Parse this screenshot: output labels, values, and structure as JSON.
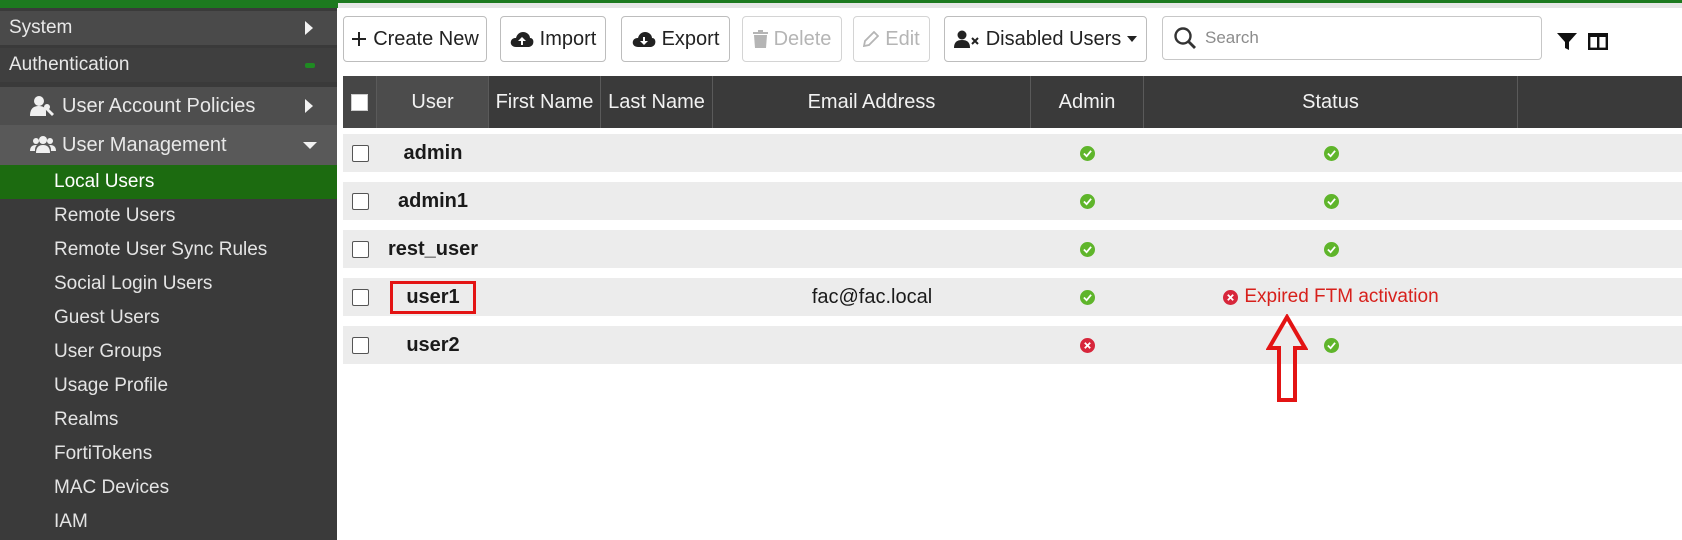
{
  "sidebar": {
    "system": "System",
    "authentication": "Authentication",
    "user_account_policies": "User Account Policies",
    "user_management": "User Management",
    "items": [
      {
        "label": "Local Users",
        "active": true
      },
      {
        "label": "Remote Users"
      },
      {
        "label": "Remote User Sync Rules"
      },
      {
        "label": "Social Login Users"
      },
      {
        "label": "Guest Users"
      },
      {
        "label": "User Groups"
      },
      {
        "label": "Usage Profile"
      },
      {
        "label": "Realms"
      },
      {
        "label": "FortiTokens"
      },
      {
        "label": "MAC Devices"
      },
      {
        "label": "IAM"
      }
    ]
  },
  "toolbar": {
    "create_new": "Create New",
    "import": "Import",
    "export": "Export",
    "delete": "Delete",
    "edit": "Edit",
    "disabled_users": "Disabled Users",
    "search_placeholder": "Search"
  },
  "table": {
    "headers": {
      "user": "User",
      "first_name": "First Name",
      "last_name": "Last Name",
      "email": "Email Address",
      "admin": "Admin",
      "status": "Status"
    },
    "rows": [
      {
        "user": "admin",
        "first_name": "",
        "last_name": "",
        "email": "",
        "admin": "ok",
        "status": "ok",
        "status_text": ""
      },
      {
        "user": "admin1",
        "first_name": "",
        "last_name": "",
        "email": "",
        "admin": "ok",
        "status": "ok",
        "status_text": ""
      },
      {
        "user": "rest_user",
        "first_name": "",
        "last_name": "",
        "email": "",
        "admin": "ok",
        "status": "ok",
        "status_text": ""
      },
      {
        "user": "user1",
        "first_name": "",
        "last_name": "",
        "email": "fac@fac.local",
        "admin": "ok",
        "status": "error",
        "status_text": "Expired FTM activation"
      },
      {
        "user": "user2",
        "first_name": "",
        "last_name": "",
        "email": "",
        "admin": "error",
        "status": "ok",
        "status_text": ""
      }
    ]
  },
  "colors": {
    "accent_green": "#1c6b10",
    "ok_green": "#5fb52b",
    "error_red": "#d7201b",
    "highlight_red": "#e31414"
  }
}
